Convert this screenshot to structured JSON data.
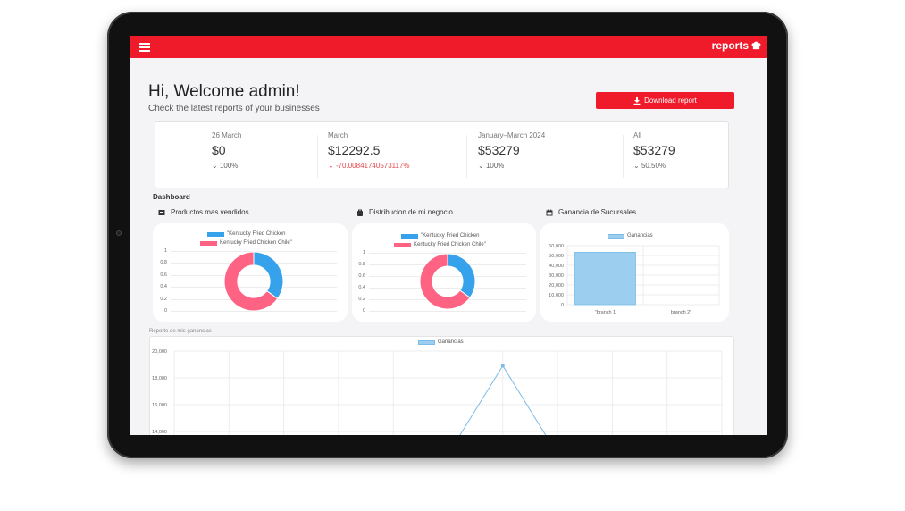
{
  "brand": {
    "name": "reports",
    "icon": "chef-hat-icon"
  },
  "menu_icon": "menu-icon",
  "welcome": {
    "title": "Hi, Welcome admin!",
    "subtitle": "Check the latest reports of your businesses"
  },
  "download_button": {
    "label": "Download report",
    "icon": "download-icon"
  },
  "stats": [
    {
      "label": "26 March",
      "value": "$0",
      "change": "100%",
      "direction": "down"
    },
    {
      "label": "March",
      "value": "$12292.5",
      "change": "-70.00841740573117%",
      "direction": "down"
    },
    {
      "label": "January–March 2024",
      "value": "$53279",
      "change": "100%",
      "direction": "down"
    },
    {
      "label": "All",
      "value": "$53279",
      "change": "50.50%",
      "direction": "down"
    }
  ],
  "dashboard_title": "Dashboard",
  "sections": [
    {
      "title": "Productos mas vendidos",
      "icon": "box-icon"
    },
    {
      "title": "Distribucion de mi negocio",
      "icon": "bag-icon"
    },
    {
      "title": "Ganancia de Sucursales",
      "icon": "calendar-icon"
    }
  ],
  "colors": {
    "accent": "#ef1b2b",
    "blue": "#36a2eb",
    "pink": "#ff6384",
    "lightblue": "#9ccfef"
  },
  "chart_data": [
    {
      "type": "pie",
      "legend": [
        "\"Kentucky Fried Chicken",
        "Kentucky Fried Chicken Chile\""
      ],
      "values": [
        35,
        65
      ],
      "yticks": [
        "1",
        "0.8",
        "0.6",
        "0.4",
        "0.2",
        "0"
      ]
    },
    {
      "type": "pie",
      "legend": [
        "\"Kentucky Fried Chicken",
        "Kentucky Fried Chicken Chile\""
      ],
      "values": [
        35,
        65
      ],
      "yticks": [
        "1",
        "0.8",
        "0.6",
        "0.4",
        "0.2",
        "0"
      ]
    },
    {
      "type": "bar",
      "legend": "Ganancias",
      "categories": [
        "\"branch 1",
        "branch 2\""
      ],
      "values": [
        53279,
        0
      ],
      "ylim": [
        0,
        60000
      ],
      "yticks": [
        "60,000",
        "50,000",
        "40,000",
        "30,000",
        "20,000",
        "10,000",
        "0"
      ]
    },
    {
      "type": "line",
      "title": "Reporte de mis ganancias",
      "legend": "Ganancias",
      "ylim": [
        14000,
        20000
      ],
      "yticks": [
        "20,000",
        "18,000",
        "16,000",
        "14,000"
      ],
      "x_count": 11,
      "values": [
        null,
        null,
        null,
        null,
        null,
        12292.5,
        18900,
        12292.5,
        null,
        null,
        null
      ]
    }
  ]
}
